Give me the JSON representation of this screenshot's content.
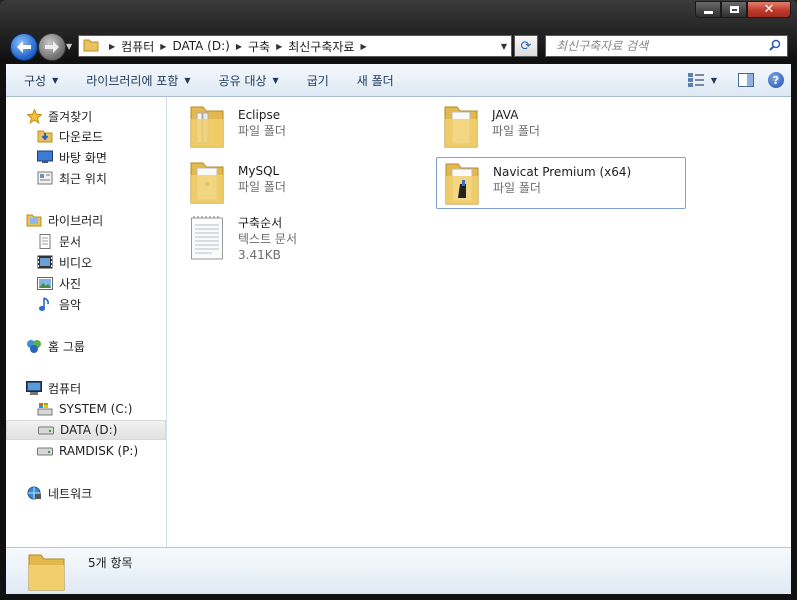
{
  "window": {
    "caption": {
      "minimize": "minimize",
      "maximize": "maximize",
      "close": "✕"
    }
  },
  "address": {
    "crumbs": [
      "컴퓨터",
      "DATA (D:)",
      "구축",
      "최신구축자료"
    ]
  },
  "search": {
    "placeholder": "최신구축자료 검색"
  },
  "toolbar": {
    "organize": "구성",
    "include_library": "라이브러리에 포함",
    "share_with": "공유 대상",
    "burn": "굽기",
    "new_folder": "새 폴더"
  },
  "nav": {
    "favorites": {
      "label": "즐겨찾기",
      "items": [
        "다운로드",
        "바탕 화면",
        "최근 위치"
      ]
    },
    "libraries": {
      "label": "라이브러리",
      "items": [
        "문서",
        "비디오",
        "사진",
        "음악"
      ]
    },
    "homegroup": {
      "label": "홈 그룹"
    },
    "computer": {
      "label": "컴퓨터",
      "items": [
        "SYSTEM (C:)",
        "DATA (D:)",
        "RAMDISK (P:)"
      ]
    },
    "network": {
      "label": "네트워크"
    }
  },
  "files": [
    {
      "name": "Eclipse",
      "type": "파일 폴더"
    },
    {
      "name": "JAVA",
      "type": "파일 폴더"
    },
    {
      "name": "MySQL",
      "type": "파일 폴더"
    },
    {
      "name": "Navicat Premium (x64)",
      "type": "파일 폴더"
    },
    {
      "name": "구축순서",
      "type": "텍스트 문서",
      "size": "3.41KB"
    }
  ],
  "status": {
    "count": "5개 항목"
  }
}
